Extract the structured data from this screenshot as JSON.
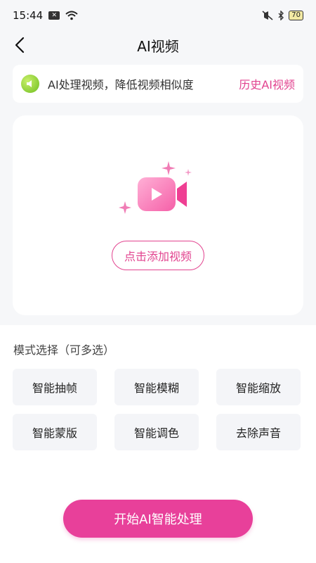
{
  "status_bar": {
    "time": "15:44",
    "battery": "70"
  },
  "header": {
    "title": "AI视频"
  },
  "tip": {
    "text": "AI处理视频，降低视频相似度",
    "history_link": "历史AI视频"
  },
  "upload": {
    "add_button": "点击添加视频"
  },
  "modes": {
    "title": "模式选择（可多选）",
    "items": [
      {
        "label": "智能抽帧"
      },
      {
        "label": "智能模糊"
      },
      {
        "label": "智能缩放"
      },
      {
        "label": "智能蒙版"
      },
      {
        "label": "智能调色"
      },
      {
        "label": "去除声音"
      }
    ]
  },
  "actions": {
    "start_label": "开始AI智能处理"
  },
  "colors": {
    "accent": "#e8409a",
    "tip_icon": "#8fd33a",
    "background": "#f6f7f9"
  }
}
